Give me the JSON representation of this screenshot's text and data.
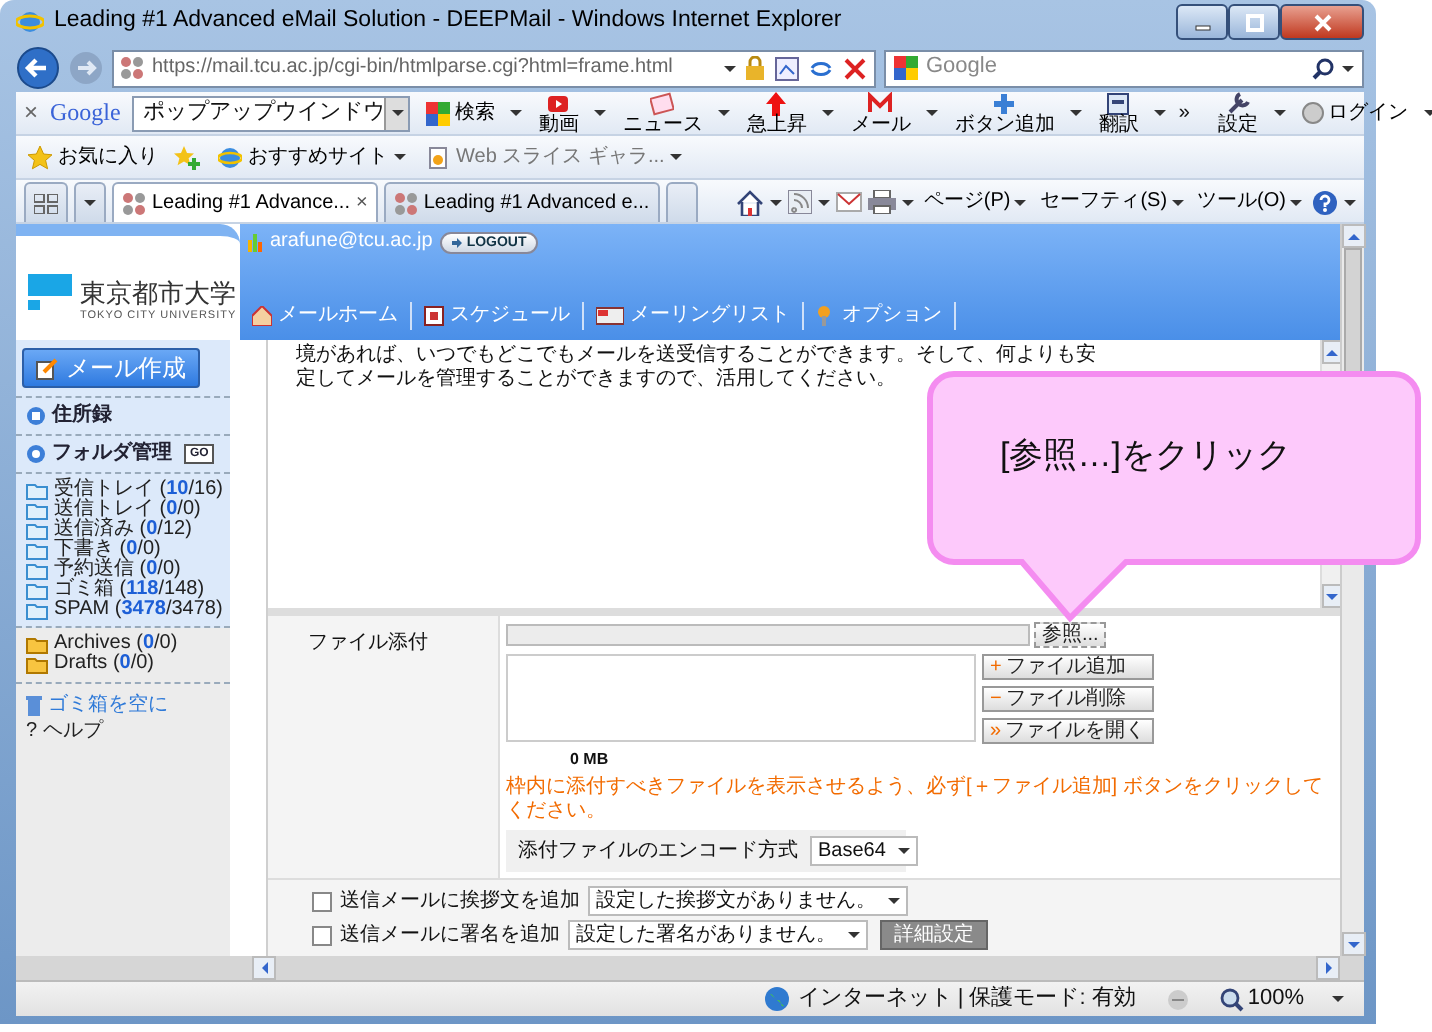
{
  "window": {
    "title": "Leading #1 Advanced eMail Solution - DEEPMail - Windows Internet Explorer"
  },
  "address_bar": {
    "url": "https://mail.tcu.ac.jp/cgi-bin/htmlparse.cgi?html=frame.html"
  },
  "search_box": {
    "placeholder": "Google"
  },
  "google_toolbar": {
    "close": "×",
    "logo": "Google",
    "query": "ポップアップウインドウ",
    "search_label": "検索",
    "buttons": [
      {
        "kind": "video",
        "label": "動画"
      },
      {
        "kind": "news",
        "label": "ニュース"
      },
      {
        "kind": "trending",
        "label": "急上昇"
      },
      {
        "kind": "mail",
        "label": "メール"
      },
      {
        "kind": "add",
        "label": "ボタン追加"
      },
      {
        "kind": "translate",
        "label": "翻訳"
      }
    ],
    "more": "»",
    "settings": "設定",
    "login": "ログイン"
  },
  "favorites_bar": {
    "favorites": "お気に入り",
    "items": [
      {
        "kind": "site",
        "label": "おすすめサイト"
      },
      {
        "kind": "slice",
        "label": "Web スライス ギャラ..."
      }
    ]
  },
  "tabs": [
    {
      "label": "Leading #1 Advance...",
      "selected": true,
      "close": "×"
    },
    {
      "label": "Leading #1 Advanced e...",
      "selected": false
    }
  ],
  "command_bar": [
    "ページ(P)",
    "セーフティ(S)",
    "ツール(O)"
  ],
  "page": {
    "logo": {
      "name": "東京都市大学",
      "subtitle": "TOKYO CITY UNIVERSITY"
    },
    "user": "arafune@tcu.ac.jp",
    "logout": "LOGOUT",
    "nav": [
      {
        "kind": "home",
        "label": "メールホーム"
      },
      {
        "kind": "schedule",
        "label": "スケジュール"
      },
      {
        "kind": "list",
        "label": "メーリングリスト"
      },
      {
        "kind": "options",
        "label": "オプション"
      }
    ],
    "sidebar": {
      "compose": "メール作成",
      "address_book": "住所録",
      "folder_manage": "フォルダ管理",
      "go": "GO",
      "folders": [
        "受信トレイ (**10**/16)",
        "送信トレイ (**0**/0)",
        "送信済み (**0**/12)",
        "下書き (**0**/0)",
        "予約送信 (**0**/0)",
        "ゴミ箱 (**118**/148)",
        "SPAM (**3478**/3478)"
      ],
      "local_folders": [
        "Archives (**0**/0)",
        "Drafts (**0**/0)"
      ],
      "empty_trash": "ゴミ箱を空に",
      "help_mark": "?",
      "help": "ヘルプ"
    },
    "message_lines": [
      "境があれば、いつでもどこでもメールを送受信することができます。そして、何よりも安",
      "定してメールを管理することができますので、活用してください。"
    ],
    "attachment": {
      "label": "ファイル添付",
      "browse": "参照...",
      "buttons": [
        {
          "mark": "+",
          "label": "ファイル追加"
        },
        {
          "mark": "−",
          "label": "ファイル削除"
        },
        {
          "mark": "»",
          "label": "ファイルを開く"
        }
      ],
      "size": "0 MB",
      "note": "枠内に添付すべきファイルを表示させるよう、必ず[＋ファイル追加] ボタンをクリックしてください。",
      "encoding_label": "添付ファイルのエンコード方式",
      "encoding": "Base64"
    },
    "options": [
      {
        "label": "送信メールに挨拶文を追加",
        "checked": false,
        "value": "設定した挨拶文がありません。"
      },
      {
        "label": "送信メールに署名を追加",
        "checked": false,
        "value": "設定した署名がありません。"
      }
    ],
    "details_button": "詳細設定"
  },
  "status_bar": {
    "zone": "インターネット | 保護モード: 有効",
    "zoom": "100%"
  },
  "callout": {
    "text": "[参照…]をクリック"
  }
}
